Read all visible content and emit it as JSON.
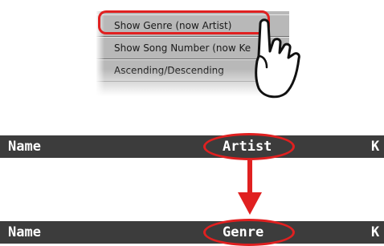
{
  "menu": {
    "items": [
      {
        "label": "Show Genre (now Artist)"
      },
      {
        "label": "Show Song Number (now Ke"
      },
      {
        "label": "Ascending/Descending"
      }
    ]
  },
  "header_before": {
    "col1": "Name",
    "col2": "Artist",
    "col3": "K"
  },
  "header_after": {
    "col1": "Name",
    "col2": "Genre",
    "col3": "K"
  },
  "colors": {
    "highlight": "#e02020",
    "bar": "#3c3c3c",
    "menu_bg": "#b8b8b8"
  },
  "icons": {
    "pointer": "pointing-hand-icon",
    "arrow": "arrow-down-icon"
  }
}
